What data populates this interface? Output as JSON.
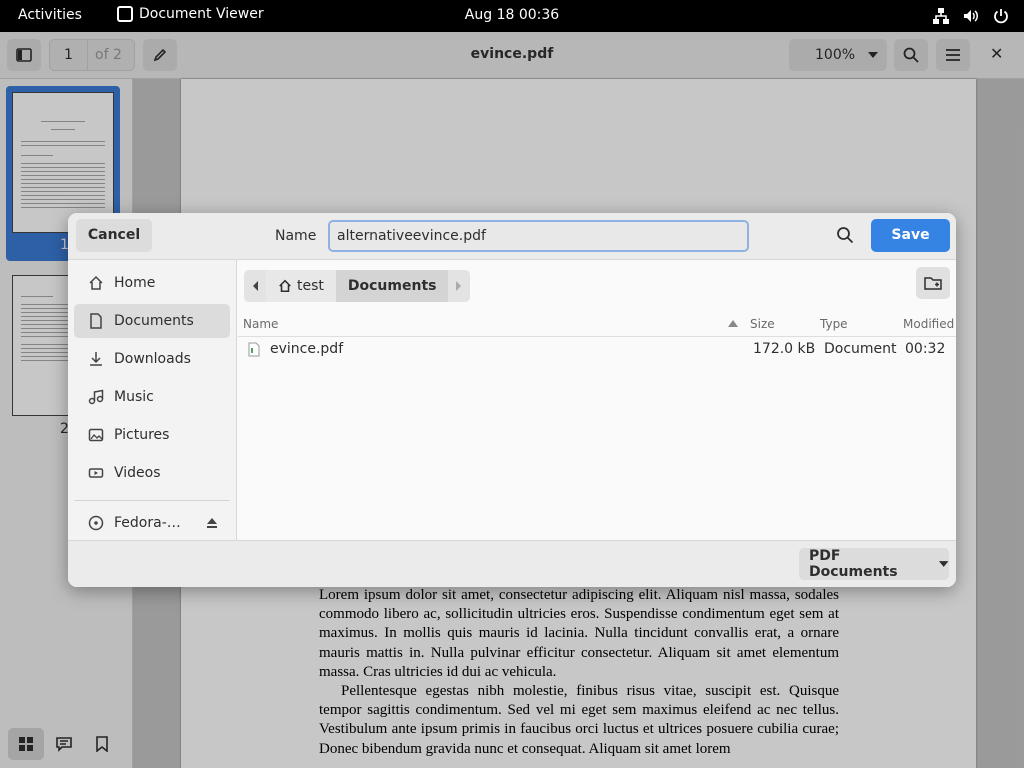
{
  "topbar": {
    "activities": "Activities",
    "app_name": "Document Viewer",
    "clock": "Aug 18  00:36"
  },
  "header": {
    "page_number": "1",
    "page_of": "of 2",
    "title": "evince.pdf",
    "zoom": "100%"
  },
  "sidebar": {
    "thumb_labels": [
      "1",
      "2"
    ]
  },
  "document": {
    "paragraph_1": "Lorem ipsum dolor sit amet, consectetur adipiscing elit.  Aliquam nisl massa, sodales commodo libero ac, sollicitudin ultricies eros. Suspendisse condimentum eget sem at maximus. In mollis quis mauris id lacinia. Nulla tincidunt convallis erat, a ornare mauris mattis in. Nulla pulvinar efficitur consectetur. Aliquam sit amet elementum massa. Cras ultricies id dui ac vehicula.",
    "paragraph_2": "Pellentesque egestas nibh molestie, finibus risus vitae, suscipit est. Quisque tempor sagittis condimentum. Sed vel mi eget sem maximus eleifend ac nec tellus. Vestibulum ante ipsum primis in faucibus orci luctus et ultrices posuere cubilia curae; Donec bibendum gravida nunc et consequat. Aliquam sit amet lorem"
  },
  "dialog": {
    "cancel_label": "Cancel",
    "name_label": "Name",
    "name_value": "alternativeevince.pdf",
    "save_label": "Save",
    "places": [
      {
        "label": "Home",
        "icon": "home-icon"
      },
      {
        "label": "Documents",
        "icon": "document-icon"
      },
      {
        "label": "Downloads",
        "icon": "download-icon"
      },
      {
        "label": "Music",
        "icon": "music-icon"
      },
      {
        "label": "Pictures",
        "icon": "picture-icon"
      },
      {
        "label": "Videos",
        "icon": "video-icon"
      },
      {
        "label": "Fedora-…",
        "icon": "disc-icon"
      }
    ],
    "path": [
      "test",
      "Documents"
    ],
    "columns": {
      "name": "Name",
      "size": "Size",
      "type": "Type",
      "modified": "Modified"
    },
    "files": [
      {
        "name": "evince.pdf",
        "size": "172.0 kB",
        "type": "Document",
        "modified": "00:32"
      }
    ],
    "filter_label": "PDF Documents"
  },
  "colors": {
    "accent": "#3584e4",
    "topbar": "#000000",
    "selection": "#3a7bd5"
  }
}
